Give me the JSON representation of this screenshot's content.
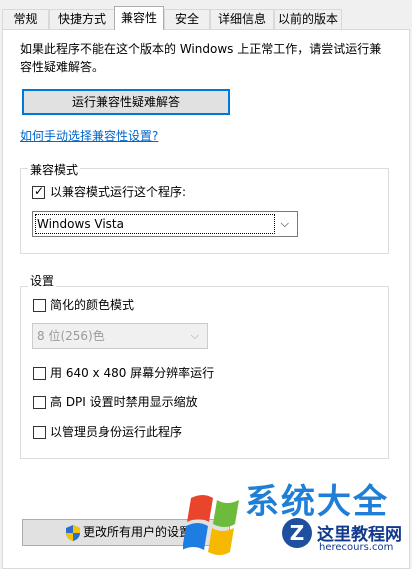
{
  "tabs": [
    "常规",
    "快捷方式",
    "兼容性",
    "安全",
    "详细信息",
    "以前的版本"
  ],
  "intro_text": "如果此程序不能在这个版本的 Windows 上正常工作，请尝试运行兼容性疑难解答。",
  "troubleshoot_button": "运行兼容性疑难解答",
  "manual_link": "如何手动选择兼容性设置?",
  "compat_mode": {
    "title": "兼容模式",
    "checkbox_label": "以兼容模式运行这个程序:",
    "checked": true,
    "selected_os": "Windows Vista"
  },
  "settings": {
    "title": "设置",
    "reduced_color_label": "简化的颜色模式",
    "color_depth": "8 位(256)色",
    "res_label": "用 640 x 480 屏幕分辨率运行",
    "dpi_label": "高 DPI 设置时禁用显示缩放",
    "admin_label": "以管理员身份运行此程序"
  },
  "all_users_button": "更改所有用户的设置",
  "watermark": {
    "site_cn": "系统大全",
    "tutorial": "这里教程网",
    "domain": "herecours.com"
  },
  "colors": {
    "accent": "#0078d7",
    "link": "#0066cc"
  }
}
